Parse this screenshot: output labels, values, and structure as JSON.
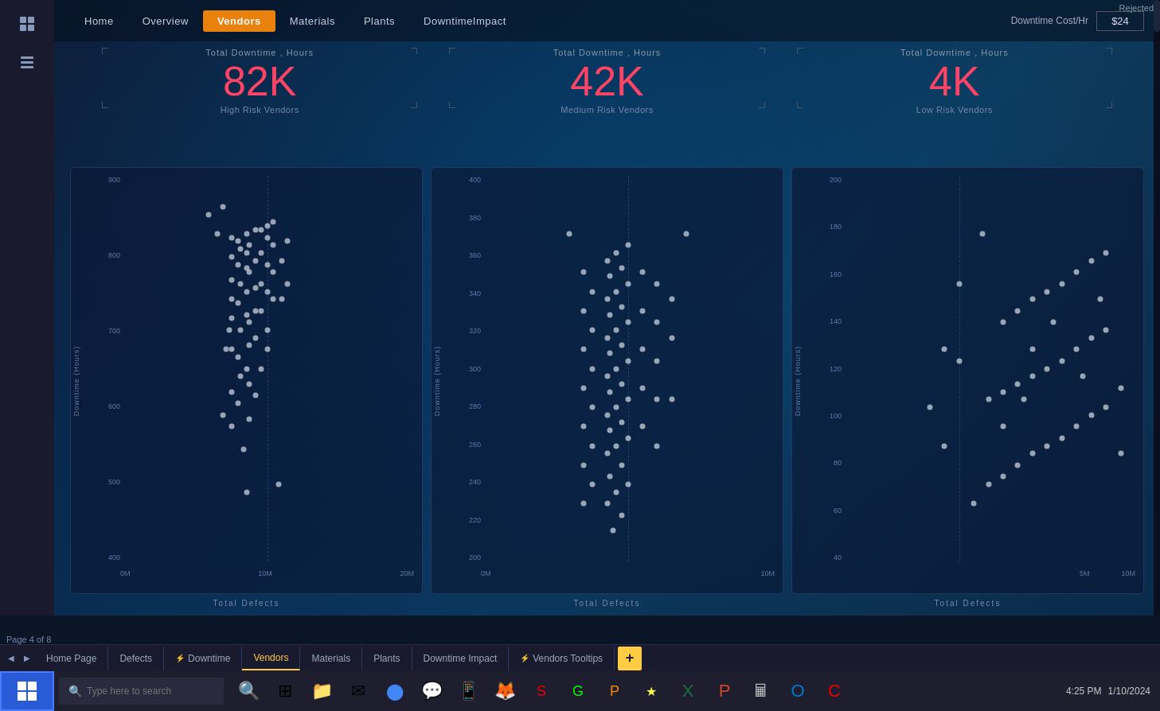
{
  "nav": {
    "items": [
      {
        "label": "Home",
        "active": false
      },
      {
        "label": "Overview",
        "active": false
      },
      {
        "label": "Vendors",
        "active": true
      },
      {
        "label": "Materials",
        "active": false
      },
      {
        "label": "Plants",
        "active": false
      },
      {
        "label": "DowntimeImpact",
        "active": false
      }
    ],
    "cost_label": "Downtime Cost/Hr",
    "cost_value": "$24"
  },
  "metrics": [
    {
      "label": "Total Downtime , Hours",
      "value": "82K",
      "sub": "High Risk Vendors"
    },
    {
      "label": "Total Downtime , Hours",
      "value": "42K",
      "sub": "Medium Risk Vendors"
    },
    {
      "label": "Total Downtime , Hours",
      "value": "4K",
      "sub": "Low Risk Vendors"
    }
  ],
  "charts": [
    {
      "y_label": "Downtime (Hours)",
      "x_label": "Total Defects",
      "y_ticks": [
        "900",
        "800",
        "700",
        "600",
        "500",
        "400"
      ],
      "x_ticks": [
        "0M",
        "10M",
        "20M"
      ],
      "dashed_x": 0.5
    },
    {
      "y_label": "Downtime (Hours)",
      "x_label": "Total Defects",
      "y_ticks": [
        "400",
        "380",
        "360",
        "340",
        "320",
        "300",
        "280",
        "260",
        "240",
        "220",
        "200"
      ],
      "x_ticks": [
        "0M",
        "10M"
      ],
      "dashed_x": 0.5
    },
    {
      "y_label": "Downtime (Hours)",
      "x_label": "Total Defects",
      "y_ticks": [
        "200",
        "180",
        "160",
        "140",
        "120",
        "100",
        "80",
        "60",
        "40"
      ],
      "x_ticks": [
        "5M",
        "10M"
      ],
      "dashed_x": 0.4
    }
  ],
  "scatter_data": {
    "chart1": [
      [
        0.42,
        0.29
      ],
      [
        0.43,
        0.18
      ],
      [
        0.38,
        0.35
      ],
      [
        0.44,
        0.37
      ],
      [
        0.4,
        0.41
      ],
      [
        0.38,
        0.44
      ],
      [
        0.44,
        0.46
      ],
      [
        0.41,
        0.48
      ],
      [
        0.46,
        0.43
      ],
      [
        0.43,
        0.5
      ],
      [
        0.4,
        0.53
      ],
      [
        0.38,
        0.55
      ],
      [
        0.44,
        0.56
      ],
      [
        0.46,
        0.58
      ],
      [
        0.41,
        0.6
      ],
      [
        0.44,
        0.62
      ],
      [
        0.38,
        0.63
      ],
      [
        0.43,
        0.64
      ],
      [
        0.46,
        0.65
      ],
      [
        0.4,
        0.67
      ],
      [
        0.38,
        0.68
      ],
      [
        0.43,
        0.7
      ],
      [
        0.46,
        0.71
      ],
      [
        0.41,
        0.72
      ],
      [
        0.38,
        0.73
      ],
      [
        0.44,
        0.75
      ],
      [
        0.43,
        0.76
      ],
      [
        0.4,
        0.77
      ],
      [
        0.46,
        0.78
      ],
      [
        0.38,
        0.79
      ],
      [
        0.43,
        0.8
      ],
      [
        0.41,
        0.81
      ],
      [
        0.44,
        0.82
      ],
      [
        0.4,
        0.83
      ],
      [
        0.38,
        0.84
      ],
      [
        0.43,
        0.85
      ],
      [
        0.46,
        0.86
      ],
      [
        0.5,
        0.87
      ],
      [
        0.52,
        0.88
      ],
      [
        0.54,
        0.2
      ],
      [
        0.35,
        0.38
      ],
      [
        0.36,
        0.55
      ],
      [
        0.37,
        0.6
      ],
      [
        0.48,
        0.5
      ],
      [
        0.5,
        0.55
      ],
      [
        0.5,
        0.6
      ],
      [
        0.48,
        0.65
      ],
      [
        0.52,
        0.68
      ],
      [
        0.5,
        0.7
      ],
      [
        0.48,
        0.72
      ],
      [
        0.52,
        0.75
      ],
      [
        0.5,
        0.77
      ],
      [
        0.48,
        0.8
      ],
      [
        0.52,
        0.82
      ],
      [
        0.5,
        0.84
      ],
      [
        0.48,
        0.86
      ],
      [
        0.55,
        0.68
      ],
      [
        0.57,
        0.72
      ],
      [
        0.55,
        0.78
      ],
      [
        0.57,
        0.83
      ],
      [
        0.3,
        0.9
      ],
      [
        0.33,
        0.85
      ],
      [
        0.35,
        0.92
      ]
    ],
    "chart2": [
      [
        0.45,
        0.08
      ],
      [
        0.48,
        0.12
      ],
      [
        0.43,
        0.15
      ],
      [
        0.46,
        0.18
      ],
      [
        0.5,
        0.2
      ],
      [
        0.44,
        0.22
      ],
      [
        0.48,
        0.25
      ],
      [
        0.43,
        0.28
      ],
      [
        0.46,
        0.3
      ],
      [
        0.5,
        0.32
      ],
      [
        0.44,
        0.34
      ],
      [
        0.48,
        0.36
      ],
      [
        0.43,
        0.38
      ],
      [
        0.46,
        0.4
      ],
      [
        0.5,
        0.42
      ],
      [
        0.44,
        0.44
      ],
      [
        0.48,
        0.46
      ],
      [
        0.43,
        0.48
      ],
      [
        0.46,
        0.5
      ],
      [
        0.5,
        0.52
      ],
      [
        0.44,
        0.54
      ],
      [
        0.48,
        0.56
      ],
      [
        0.43,
        0.58
      ],
      [
        0.46,
        0.6
      ],
      [
        0.5,
        0.62
      ],
      [
        0.44,
        0.64
      ],
      [
        0.48,
        0.66
      ],
      [
        0.43,
        0.68
      ],
      [
        0.46,
        0.7
      ],
      [
        0.5,
        0.72
      ],
      [
        0.44,
        0.74
      ],
      [
        0.48,
        0.76
      ],
      [
        0.43,
        0.78
      ],
      [
        0.46,
        0.8
      ],
      [
        0.5,
        0.82
      ],
      [
        0.55,
        0.35
      ],
      [
        0.55,
        0.45
      ],
      [
        0.55,
        0.55
      ],
      [
        0.55,
        0.65
      ],
      [
        0.55,
        0.75
      ],
      [
        0.6,
        0.3
      ],
      [
        0.6,
        0.42
      ],
      [
        0.6,
        0.52
      ],
      [
        0.6,
        0.62
      ],
      [
        0.6,
        0.72
      ],
      [
        0.38,
        0.2
      ],
      [
        0.38,
        0.3
      ],
      [
        0.38,
        0.4
      ],
      [
        0.38,
        0.5
      ],
      [
        0.38,
        0.6
      ],
      [
        0.38,
        0.7
      ],
      [
        0.35,
        0.15
      ],
      [
        0.35,
        0.25
      ],
      [
        0.35,
        0.35
      ],
      [
        0.35,
        0.45
      ],
      [
        0.35,
        0.55
      ],
      [
        0.35,
        0.65
      ],
      [
        0.35,
        0.75
      ],
      [
        0.65,
        0.42
      ],
      [
        0.65,
        0.58
      ],
      [
        0.65,
        0.68
      ],
      [
        0.7,
        0.85
      ],
      [
        0.3,
        0.85
      ]
    ],
    "chart3": [
      [
        0.45,
        0.15
      ],
      [
        0.5,
        0.2
      ],
      [
        0.55,
        0.22
      ],
      [
        0.6,
        0.25
      ],
      [
        0.65,
        0.28
      ],
      [
        0.7,
        0.3
      ],
      [
        0.75,
        0.32
      ],
      [
        0.8,
        0.35
      ],
      [
        0.85,
        0.38
      ],
      [
        0.9,
        0.4
      ],
      [
        0.5,
        0.42
      ],
      [
        0.55,
        0.44
      ],
      [
        0.6,
        0.46
      ],
      [
        0.65,
        0.48
      ],
      [
        0.7,
        0.5
      ],
      [
        0.75,
        0.52
      ],
      [
        0.8,
        0.55
      ],
      [
        0.85,
        0.58
      ],
      [
        0.9,
        0.6
      ],
      [
        0.55,
        0.62
      ],
      [
        0.6,
        0.65
      ],
      [
        0.65,
        0.68
      ],
      [
        0.7,
        0.7
      ],
      [
        0.75,
        0.72
      ],
      [
        0.8,
        0.75
      ],
      [
        0.85,
        0.78
      ],
      [
        0.9,
        0.8
      ],
      [
        0.4,
        0.52
      ],
      [
        0.4,
        0.72
      ],
      [
        0.95,
        0.28
      ],
      [
        0.95,
        0.45
      ],
      [
        0.35,
        0.3
      ],
      [
        0.35,
        0.55
      ],
      [
        0.3,
        0.4
      ],
      [
        0.48,
        0.85
      ],
      [
        0.62,
        0.42
      ],
      [
        0.72,
        0.62
      ],
      [
        0.82,
        0.48
      ],
      [
        0.88,
        0.68
      ],
      [
        0.55,
        0.35
      ],
      [
        0.65,
        0.55
      ]
    ]
  },
  "sheet_tabs": [
    {
      "label": "Home Page",
      "active": false,
      "icon": null
    },
    {
      "label": "Defects",
      "active": false,
      "icon": null
    },
    {
      "label": "Downtime",
      "active": false,
      "icon": "⚡"
    },
    {
      "label": "Vendors",
      "active": true,
      "icon": null
    },
    {
      "label": "Materials",
      "active": false,
      "icon": null
    },
    {
      "label": "Plants",
      "active": false,
      "icon": null
    },
    {
      "label": "Downtime Impact",
      "active": false,
      "icon": null
    },
    {
      "label": "Vendors Tooltips",
      "active": false,
      "icon": "⚡"
    }
  ],
  "page_info": "Page 4 of 8",
  "taskbar": {
    "search_placeholder": "Type here to search",
    "rejected_label": "Rejected"
  },
  "header_rejected": "Rejected"
}
